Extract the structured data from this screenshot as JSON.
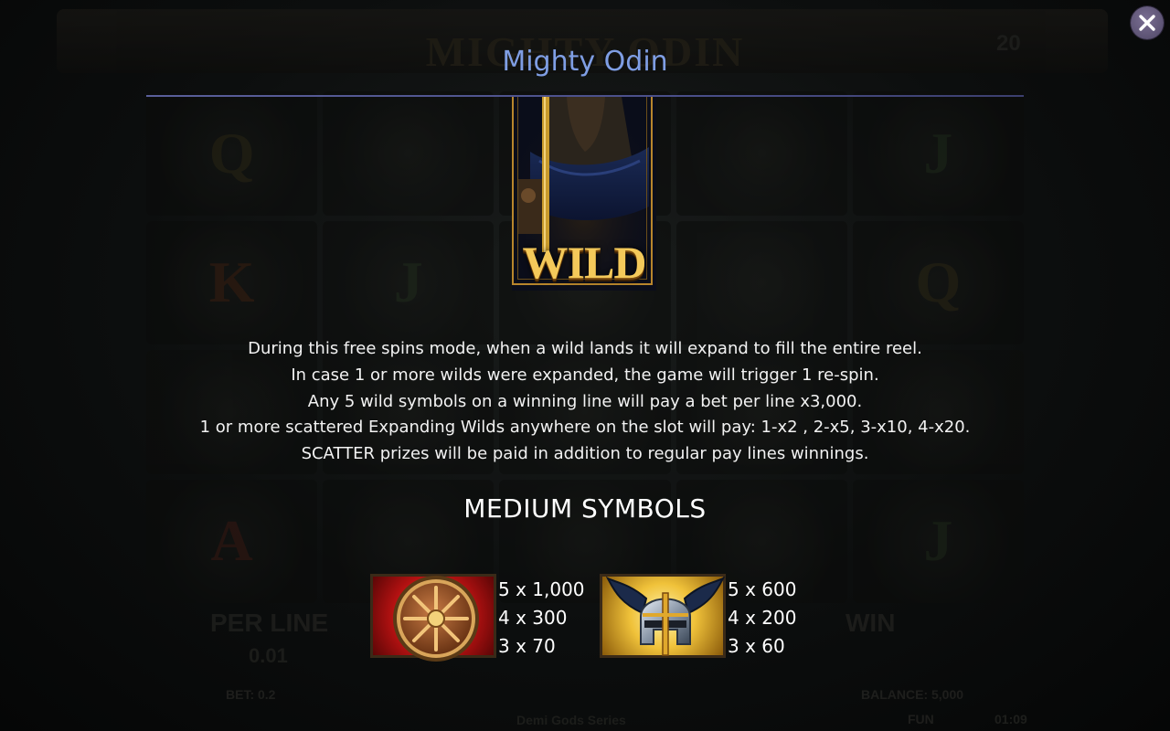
{
  "game_title": "Mighty Odin",
  "background": {
    "logo": "MIGHTY ODIN",
    "lines_count": "20",
    "reel_symbols": [
      "Q",
      "",
      "",
      "",
      "J",
      "K",
      "J",
      "",
      "",
      "Q",
      "",
      "",
      "",
      "",
      "",
      "A",
      "",
      "",
      "",
      "J"
    ],
    "per_line_label": "PER LINE",
    "per_line_value": "0.01",
    "win_label": "WIN",
    "bet_text": "BET: 0.2",
    "balance_text": "BALANCE: 5,000",
    "series_text": "Demi Gods Series",
    "mode_text": "FUN",
    "clock_text": "01:09"
  },
  "close_button": {
    "icon": "close-icon"
  },
  "wild_symbol": {
    "label": "WILD",
    "icon": "odin-wild-symbol"
  },
  "description_lines": [
    "During this free spins mode, when a wild lands it will expand to fill the entire reel.",
    "In case 1 or more wilds were expanded, the game will trigger 1 re-spin.",
    "Any 5 wild symbols on a winning line will pay a bet per line x3,000.",
    "1 or more scattered Expanding Wilds anywhere on the slot will pay: 1-x2 , 2-x5, 3-x10, 4-x20.",
    "SCATTER prizes will be paid in addition to regular pay lines winnings."
  ],
  "section_heading": "MEDIUM SYMBOLS",
  "medium_symbols": [
    {
      "icon": "shield-icon",
      "payouts": [
        "5 x 1,000",
        "4 x 300",
        "3 x 70"
      ]
    },
    {
      "icon": "winged-helmet-icon",
      "payouts": [
        "5 x 600",
        "4 x 200",
        "3 x 60"
      ]
    }
  ],
  "colors": {
    "title": "#7f9ee4",
    "rule": "#4a4f8a",
    "text": "#f2f2f2",
    "wild_gold": "#f4c95a",
    "close_button": "#5e5478"
  }
}
